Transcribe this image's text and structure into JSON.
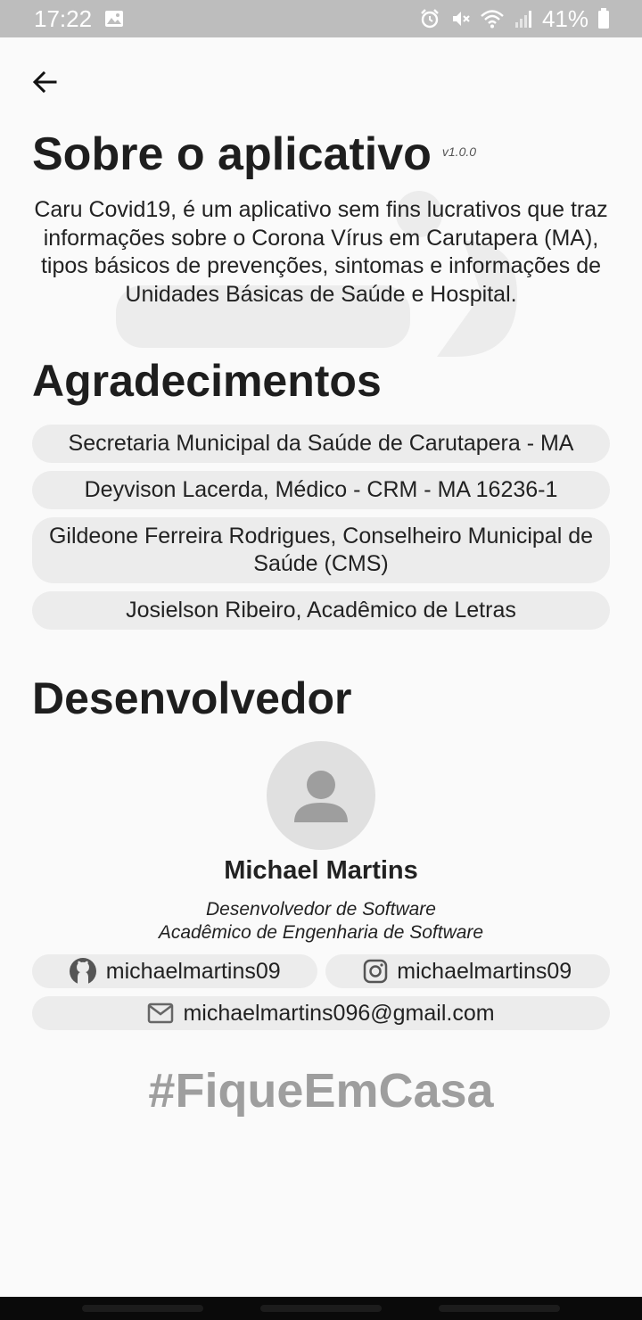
{
  "status_bar": {
    "time": "17:22",
    "battery": "41%",
    "icons": [
      "image-icon",
      "alarm-icon",
      "mute-icon",
      "wifi-icon",
      "signal-icon",
      "battery-icon"
    ]
  },
  "header": {
    "title": "Sobre o aplicativo",
    "version": "v1.0.0"
  },
  "description": "Caru Covid19, é um aplicativo sem fins lucrativos que traz informações sobre o Corona Vírus em Carutapera (MA), tipos básicos de prevenções, sintomas e informações de Unidades Básicas de Saúde e Hospital.",
  "thanks": {
    "title": "Agradecimentos",
    "items": [
      "Secretaria Municipal da Saúde de Carutapera - MA",
      "Deyvison Lacerda, Médico - CRM - MA 16236-1",
      "Gildeone Ferreira Rodrigues, Conselheiro Municipal de Saúde (CMS)",
      "Josielson Ribeiro, Acadêmico de Letras"
    ]
  },
  "developer": {
    "title": "Desenvolvedor",
    "name": "Michael Martins",
    "roles": [
      "Desenvolvedor de Software",
      "Acadêmico de Engenharia de Software"
    ],
    "github": "michaelmartins09",
    "instagram": "michaelmartins09",
    "email": "michaelmartins096@gmail.com"
  },
  "footer": {
    "hashtag": "#FiqueEmCasa"
  },
  "colors": {
    "status_bar": "#bdbdbd",
    "chip_background": "#ececec",
    "hashtag": "#9e9e9e"
  }
}
